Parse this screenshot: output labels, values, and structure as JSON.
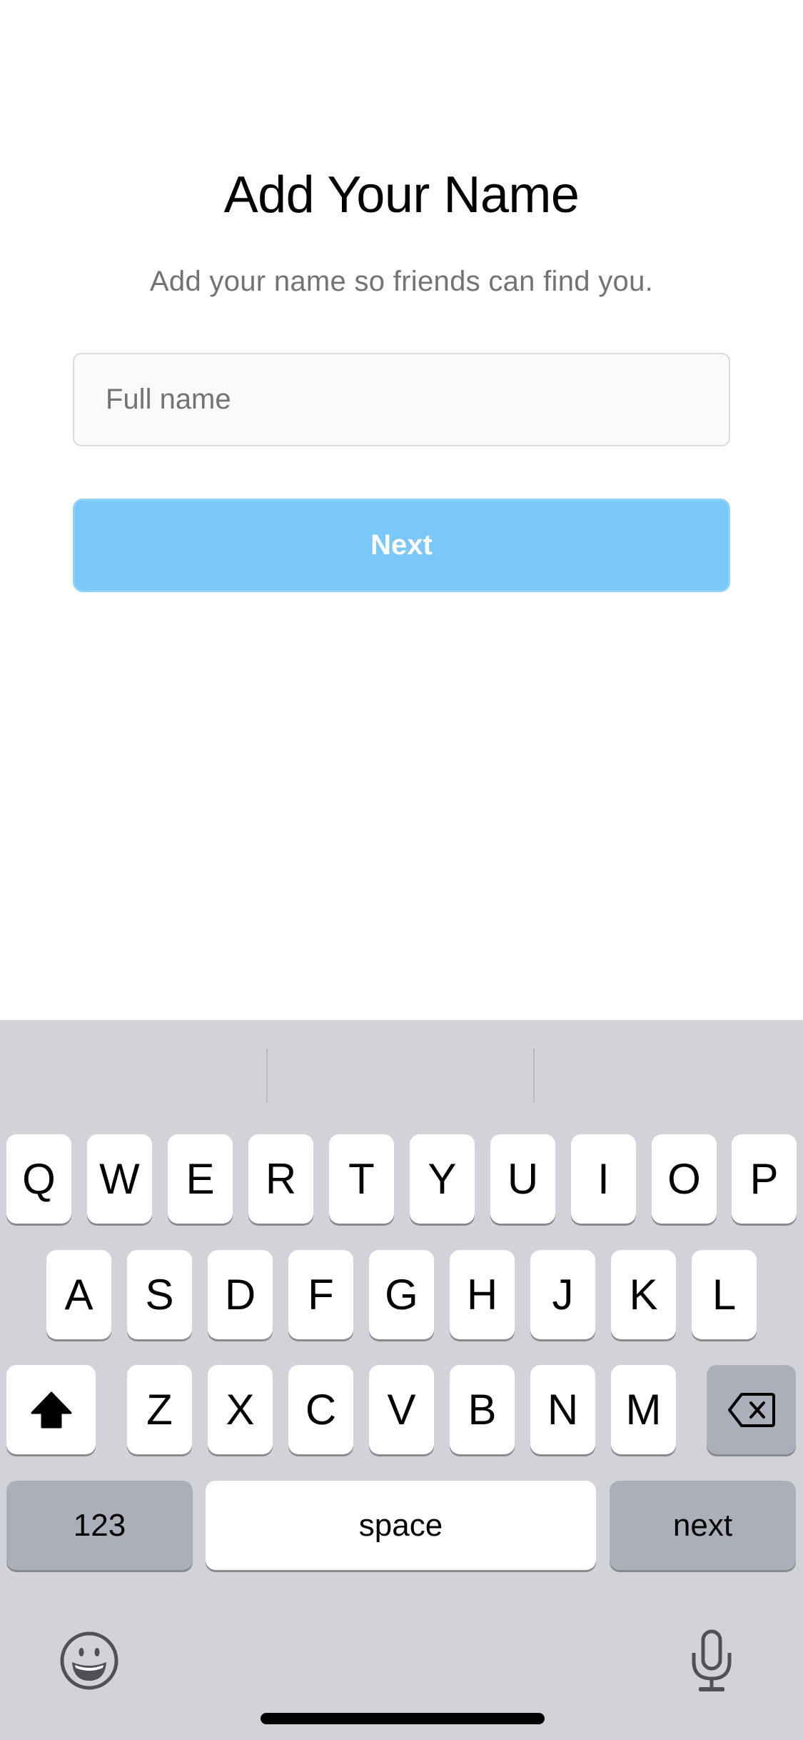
{
  "screen": {
    "title": "Add Your Name",
    "subtitle": "Add your name so friends can find you.",
    "name_input": {
      "placeholder": "Full name",
      "value": ""
    },
    "next_button": {
      "label": "Next",
      "enabled": false,
      "color": "#7ac8f9"
    }
  },
  "keyboard": {
    "row1": [
      "Q",
      "W",
      "E",
      "R",
      "T",
      "Y",
      "U",
      "I",
      "O",
      "P"
    ],
    "row2": [
      "A",
      "S",
      "D",
      "F",
      "G",
      "H",
      "J",
      "K",
      "L"
    ],
    "row3": [
      "Z",
      "X",
      "C",
      "V",
      "B",
      "N",
      "M"
    ],
    "shift_icon": "shift-arrow-icon",
    "delete_icon": "backspace-icon",
    "numbers_label": "123",
    "space_label": "space",
    "return_label": "next",
    "emoji_icon": "emoji-icon",
    "dictation_icon": "microphone-icon"
  }
}
